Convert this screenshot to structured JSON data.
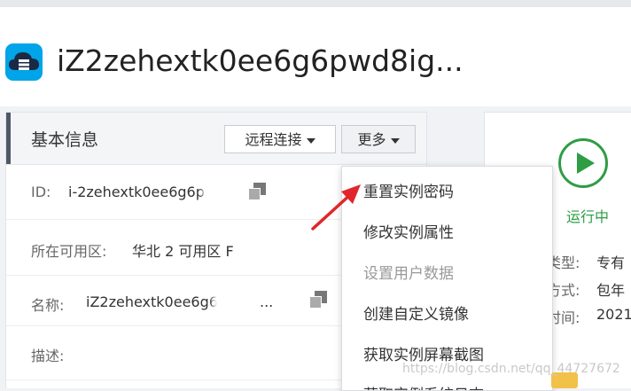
{
  "header": {
    "title": "iZ2zehextk0ee6g6pwd8ig...",
    "logo_icon": "cloud-server-icon",
    "accent_color": "#00a4e8"
  },
  "basic_info": {
    "title": "基本信息",
    "remote_button": "远程连接",
    "more_button": "更多",
    "rows": [
      {
        "label": "ID:",
        "value": "i-2zehextk0ee6g6p"
      },
      {
        "label": "所在可用区:",
        "value": "华北 2 可用区 F"
      },
      {
        "label": "名称:",
        "value": "iZ2zehextk0ee6g6"
      },
      {
        "label": "描述:",
        "value": ""
      }
    ],
    "name_ellipsis": "..."
  },
  "status": {
    "label": "运行中",
    "color": "#2e9d44",
    "icon": "play-circle-icon",
    "fields": [
      {
        "label": "类型:",
        "value": "专有"
      },
      {
        "label": "方式:",
        "value": "包年"
      },
      {
        "label": "时间:",
        "value": "2021"
      }
    ]
  },
  "more_menu": {
    "items": [
      {
        "label": "重置实例密码",
        "disabled": false
      },
      {
        "label": "修改实例属性",
        "disabled": false
      },
      {
        "label": "设置用户数据",
        "disabled": true
      },
      {
        "label": "创建自定义镜像",
        "disabled": false
      },
      {
        "label": "获取实例屏幕截图",
        "disabled": false
      },
      {
        "label": "获取实例系统日志",
        "disabled": false
      }
    ]
  },
  "annotation": {
    "arrow_color": "#e0262b"
  },
  "watermark": "https://blog.csdn.net/qq_44727672"
}
